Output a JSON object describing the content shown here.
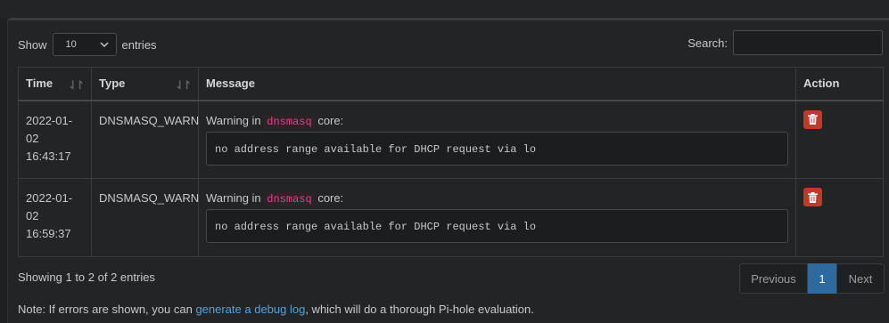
{
  "length_control": {
    "prefix": "Show",
    "value": "10",
    "suffix": "entries"
  },
  "search": {
    "label": "Search:",
    "value": ""
  },
  "table": {
    "columns": [
      "Time",
      "Type",
      "Message",
      "Action"
    ],
    "rows": [
      {
        "date": "2022-01-02",
        "time": "16:43:17",
        "type": "DNSMASQ_WARN",
        "msg_prefix": "Warning in",
        "msg_code": "dnsmasq",
        "msg_suffix": "core:",
        "detail": "no address range available for DHCP request via lo"
      },
      {
        "date": "2022-01-02",
        "time": "16:59:37",
        "type": "DNSMASQ_WARN",
        "msg_prefix": "Warning in",
        "msg_code": "dnsmasq",
        "msg_suffix": "core:",
        "detail": "no address range available for DHCP request via lo"
      }
    ]
  },
  "info": "Showing 1 to 2 of 2 entries",
  "pagination": {
    "previous": "Previous",
    "current": "1",
    "next": "Next"
  },
  "note": {
    "before": "Note: If errors are shown, you can ",
    "link": "generate a debug log",
    "after": ", which will do a thorough Pi-hole evaluation."
  },
  "colors": {
    "accent": "#2c6aa0",
    "danger": "#c0392b",
    "code": "#e83e8c",
    "link": "#5aa0d8"
  },
  "icons": {
    "sort": "sort-icon",
    "delete": "trash-icon",
    "dropdown": "chevron-down-icon"
  }
}
